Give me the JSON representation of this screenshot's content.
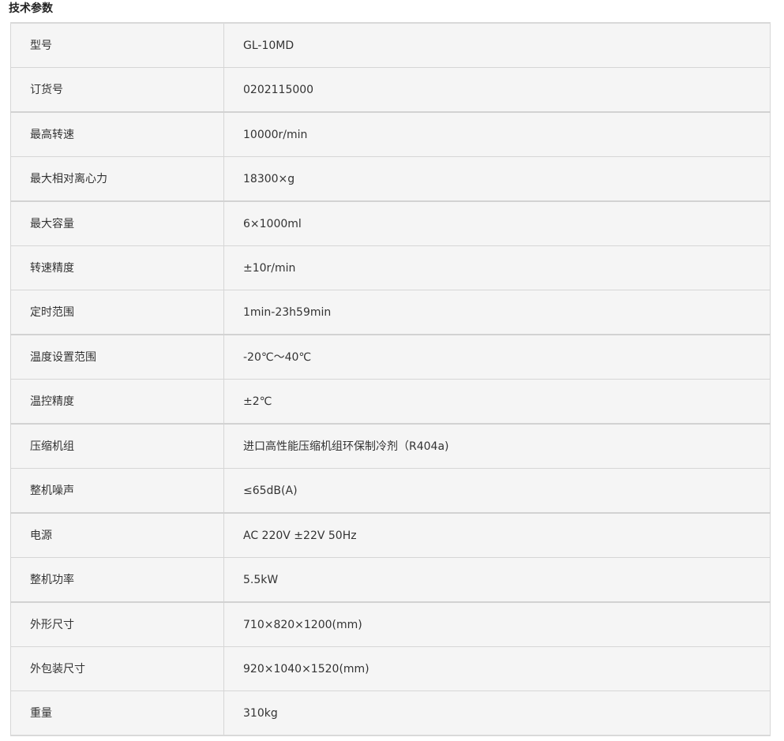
{
  "section": {
    "title": "技术参数"
  },
  "specs": [
    {
      "label": "型号",
      "value": "GL-10MD"
    },
    {
      "label": "订货号",
      "value": "0202115000"
    },
    {
      "label": "最高转速",
      "value": "10000r/min"
    },
    {
      "label": "最大相对离心力",
      "value": "18300×g"
    },
    {
      "label": "最大容量",
      "value": "6×1000ml"
    },
    {
      "label": "转速精度",
      "value": "±10r/min"
    },
    {
      "label": "定时范围",
      "value": "1min-23h59min"
    },
    {
      "label": "温度设置范围",
      "value": "-20℃～40℃"
    },
    {
      "label": "温控精度",
      "value": "±2℃"
    },
    {
      "label": "压缩机组",
      "value": "进口高性能压缩机组环保制冷剂（R404a)"
    },
    {
      "label": "整机噪声",
      "value": "≤65dB(A)"
    },
    {
      "label": "电源",
      "value": "AC 220V ±22V 50Hz"
    },
    {
      "label": "整机功率",
      "value": "5.5kW"
    },
    {
      "label": "外形尺寸",
      "value": "710×820×1200(mm)"
    },
    {
      "label": "外包装尺寸",
      "value": "920×1040×1520(mm)"
    },
    {
      "label": "重量",
      "value": "310kg"
    }
  ]
}
